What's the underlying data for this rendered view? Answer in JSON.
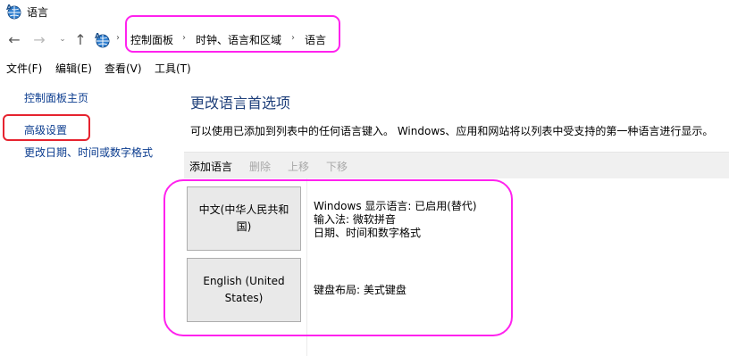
{
  "window": {
    "title": "语言"
  },
  "nav": {
    "back": "←",
    "forward": "→",
    "recent": "⌄",
    "up": "↑",
    "separator": "›",
    "breadcrumbs": [
      "控制面板",
      "时钟、语言和区域",
      "语言"
    ]
  },
  "menu": {
    "items": [
      "文件(F)",
      "编辑(E)",
      "查看(V)",
      "工具(T)"
    ]
  },
  "sidebar": {
    "links": [
      "控制面板主页",
      "高级设置",
      "更改日期、时间或数字格式"
    ]
  },
  "main": {
    "title": "更改语言首选项",
    "description": "可以使用已添加到列表中的任何语言键入。 Windows、应用和网站将以列表中受支持的第一种语言进行显示。",
    "toolbar": {
      "add": "添加语言",
      "remove": "删除",
      "move_up": "上移",
      "move_down": "下移"
    },
    "languages": [
      {
        "name": "中文(中华人民共和国)",
        "details": [
          "Windows 显示语言: 已启用(替代)",
          "输入法: 微软拼音",
          "日期、时间和数字格式"
        ]
      },
      {
        "name": "English (United States)",
        "details": [
          "键盘布局: 美式键盘"
        ]
      }
    ]
  },
  "colors": {
    "highlight_magenta": "#ff22ee",
    "highlight_red": "#e6232f",
    "link_blue": "#0b3c8f",
    "title_blue": "#1e3f7a"
  }
}
